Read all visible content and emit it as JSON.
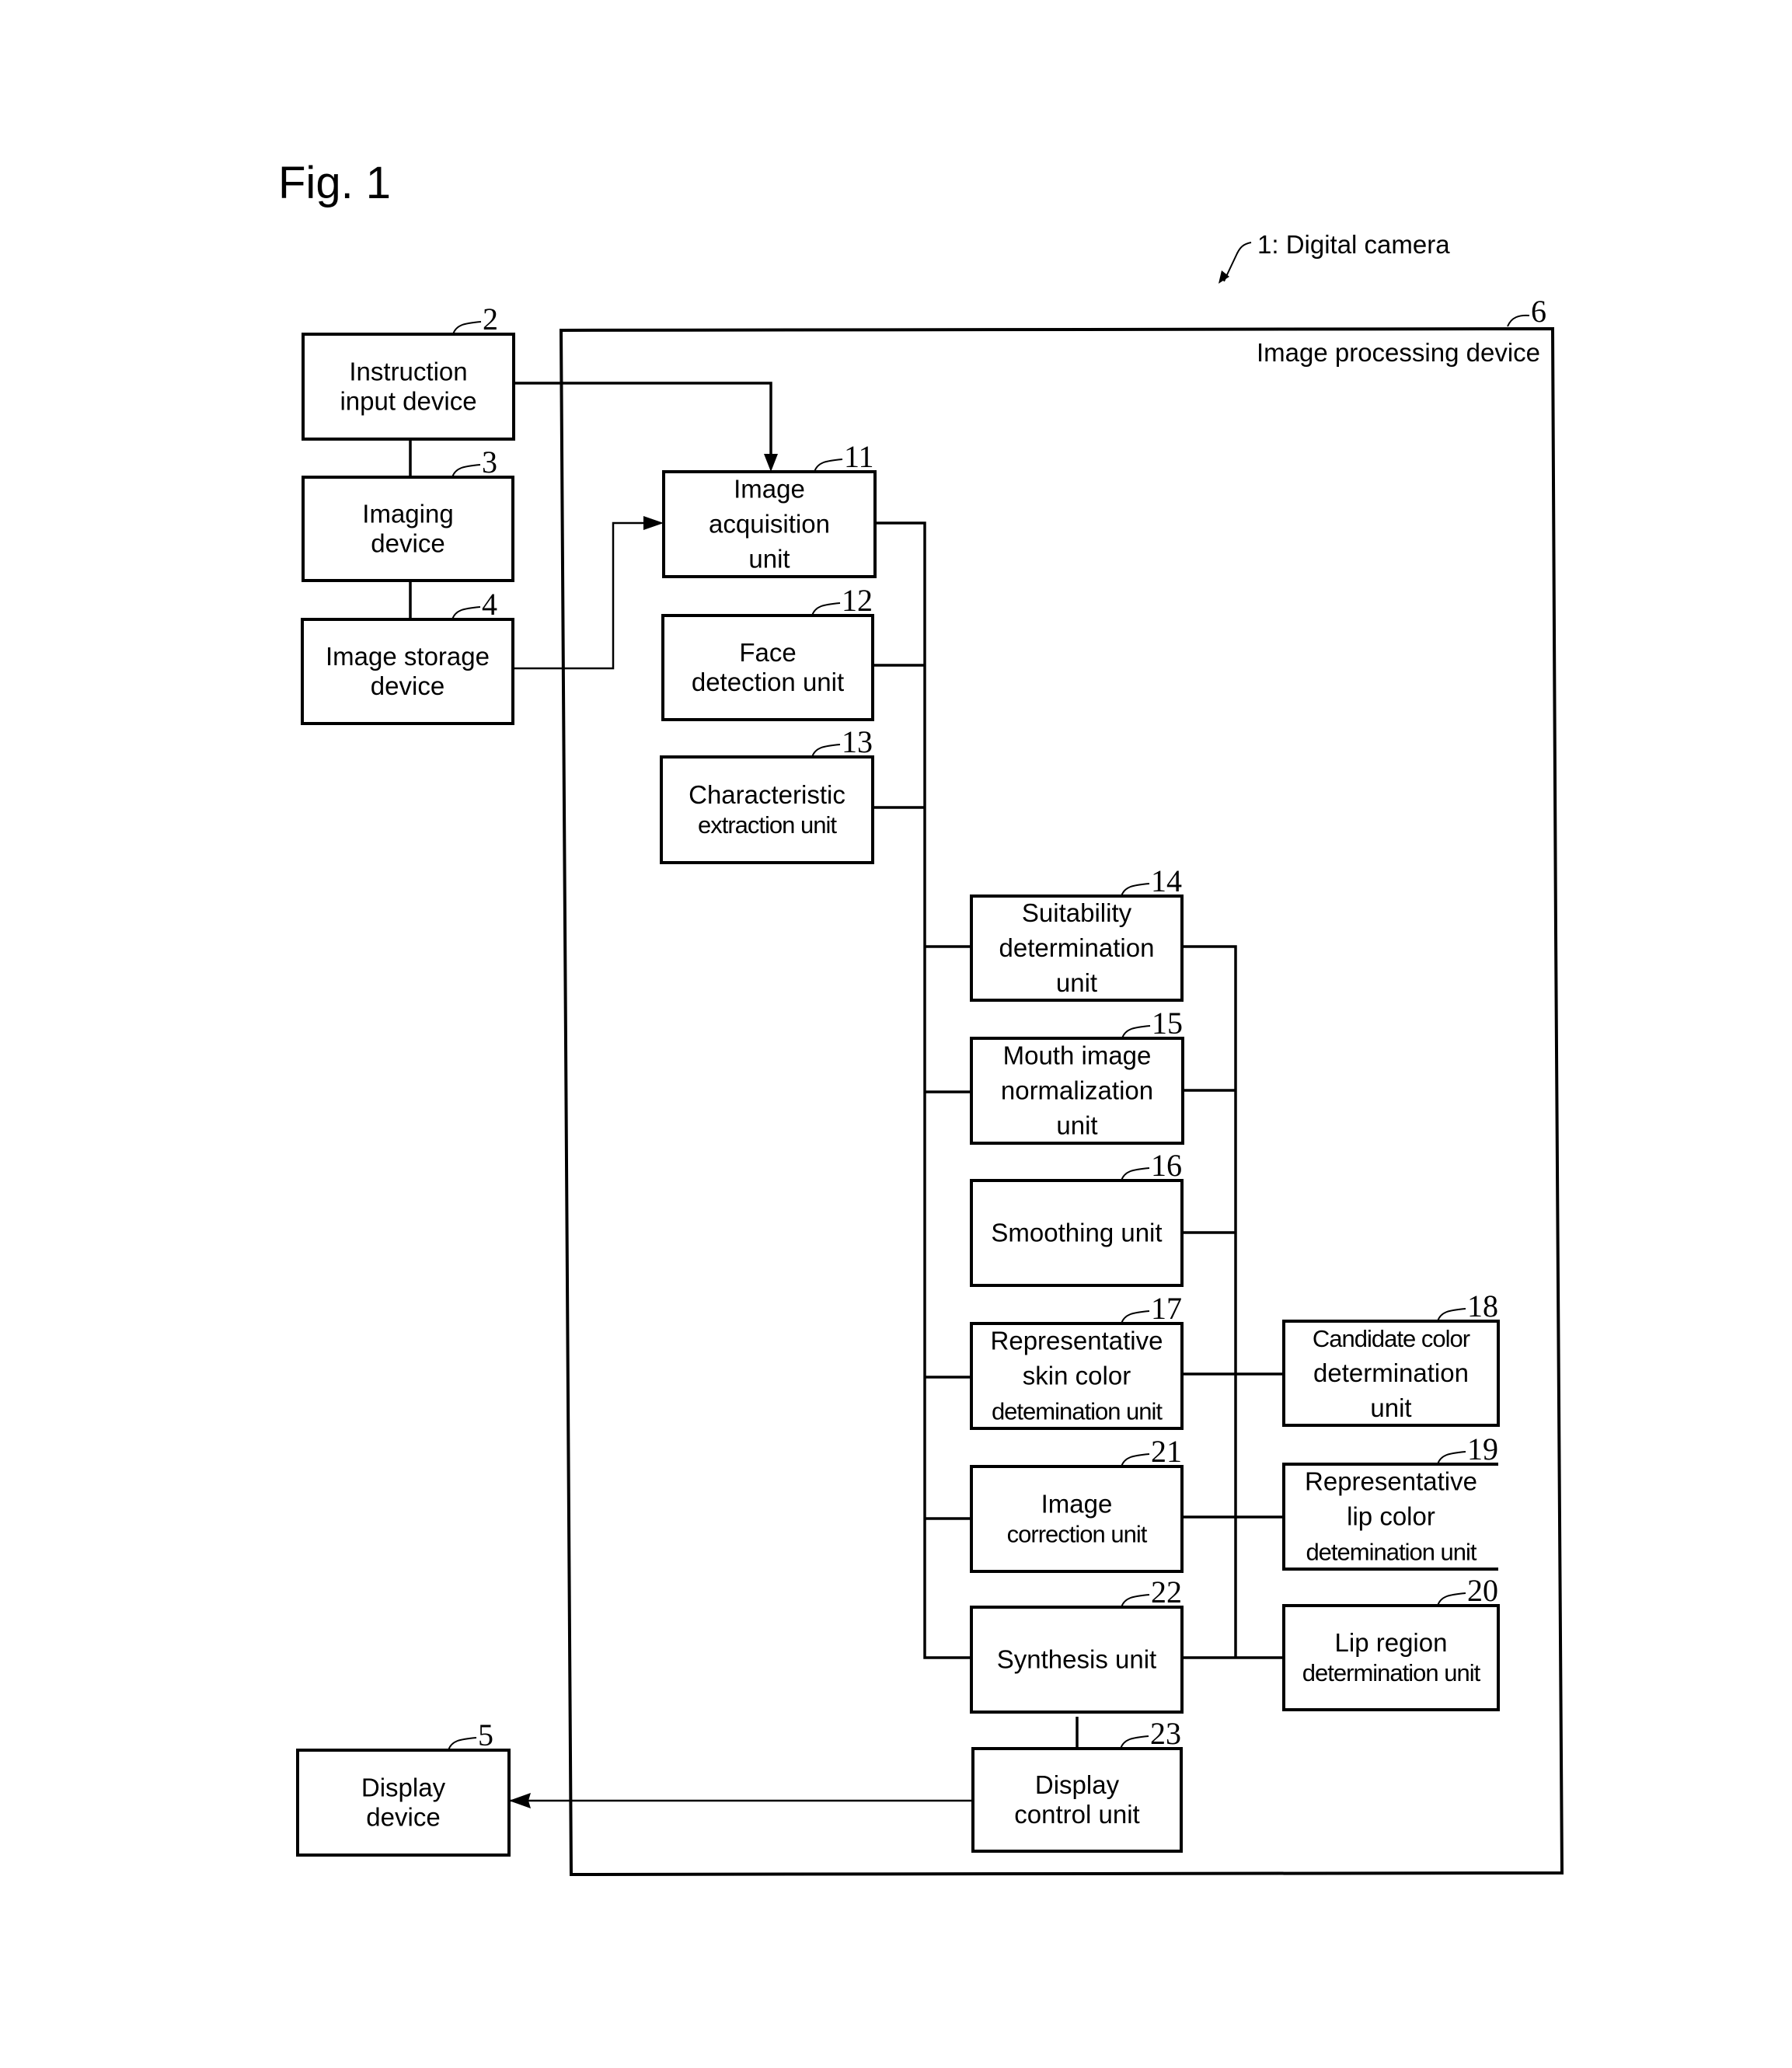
{
  "figure": {
    "title": "Fig. 1",
    "system_label": "1: Digital camera",
    "container": {
      "ref": "6",
      "label": "Image processing device"
    }
  },
  "blocks": [
    {
      "id": "instruction-input-device",
      "ref": "2",
      "lines": [
        "Instruction",
        "input device"
      ]
    },
    {
      "id": "imaging-device",
      "ref": "3",
      "lines": [
        "Imaging",
        "device"
      ]
    },
    {
      "id": "image-storage-device",
      "ref": "4",
      "lines": [
        "Image storage",
        "device"
      ]
    },
    {
      "id": "display-device",
      "ref": "5",
      "lines": [
        "Display",
        "device"
      ]
    },
    {
      "id": "image-acquisition-unit",
      "ref": "11",
      "lines": [
        "Image",
        "acquisition",
        "unit"
      ]
    },
    {
      "id": "face-detection-unit",
      "ref": "12",
      "lines": [
        "Face",
        "detection unit"
      ]
    },
    {
      "id": "characteristic-extraction-unit",
      "ref": "13",
      "lines": [
        "Characteristic",
        "extraction unit"
      ]
    },
    {
      "id": "suitability-determination-unit",
      "ref": "14",
      "lines": [
        "Suitability",
        "determination",
        "unit"
      ]
    },
    {
      "id": "mouth-image-normalization-unit",
      "ref": "15",
      "lines": [
        "Mouth image",
        "normalization",
        "unit"
      ]
    },
    {
      "id": "smoothing-unit",
      "ref": "16",
      "lines": [
        "Smoothing unit"
      ]
    },
    {
      "id": "representative-skin-color-determination-unit",
      "ref": "17",
      "lines": [
        "Representative",
        "skin color",
        "detemination unit"
      ]
    },
    {
      "id": "candidate-color-determination-unit",
      "ref": "18",
      "lines": [
        "Candidate color",
        "determination",
        "unit"
      ]
    },
    {
      "id": "representative-lip-color-determination-unit",
      "ref": "19",
      "lines": [
        "Representative",
        "lip color",
        "detemination unit"
      ]
    },
    {
      "id": "lip-region-determination-unit",
      "ref": "20",
      "lines": [
        "Lip region",
        "determination unit"
      ]
    },
    {
      "id": "image-correction-unit",
      "ref": "21",
      "lines": [
        "Image",
        "correction unit"
      ]
    },
    {
      "id": "synthesis-unit",
      "ref": "22",
      "lines": [
        "Synthesis unit"
      ]
    },
    {
      "id": "display-control-unit",
      "ref": "23",
      "lines": [
        "Display",
        "control unit"
      ]
    }
  ],
  "connections": [
    {
      "from": "2",
      "to": "11",
      "arrow": true
    },
    {
      "from": "2",
      "to": "3",
      "arrow": false
    },
    {
      "from": "3",
      "to": "4",
      "arrow": false
    },
    {
      "from": "4",
      "to": "11",
      "arrow": true
    },
    {
      "from": "11",
      "to": "bus",
      "arrow": false
    },
    {
      "from": "12",
      "to": "bus",
      "arrow": false
    },
    {
      "from": "13",
      "to": "bus",
      "arrow": false
    },
    {
      "from": "14",
      "to": "bus",
      "arrow": false
    },
    {
      "from": "15",
      "to": "bus",
      "arrow": false
    },
    {
      "from": "17",
      "to": "bus",
      "arrow": false
    },
    {
      "from": "21",
      "to": "bus",
      "arrow": false
    },
    {
      "from": "22",
      "to": "bus",
      "arrow": false
    },
    {
      "from": "14",
      "to": "bus-right",
      "arrow": false
    },
    {
      "from": "15",
      "to": "bus-right",
      "arrow": false
    },
    {
      "from": "16",
      "to": "bus-right",
      "arrow": false
    },
    {
      "from": "17",
      "to": "18",
      "arrow": false
    },
    {
      "from": "21",
      "to": "19",
      "arrow": false
    },
    {
      "from": "22",
      "to": "20",
      "arrow": false
    },
    {
      "from": "22",
      "to": "23",
      "arrow": false
    },
    {
      "from": "23",
      "to": "5",
      "arrow": true
    }
  ]
}
